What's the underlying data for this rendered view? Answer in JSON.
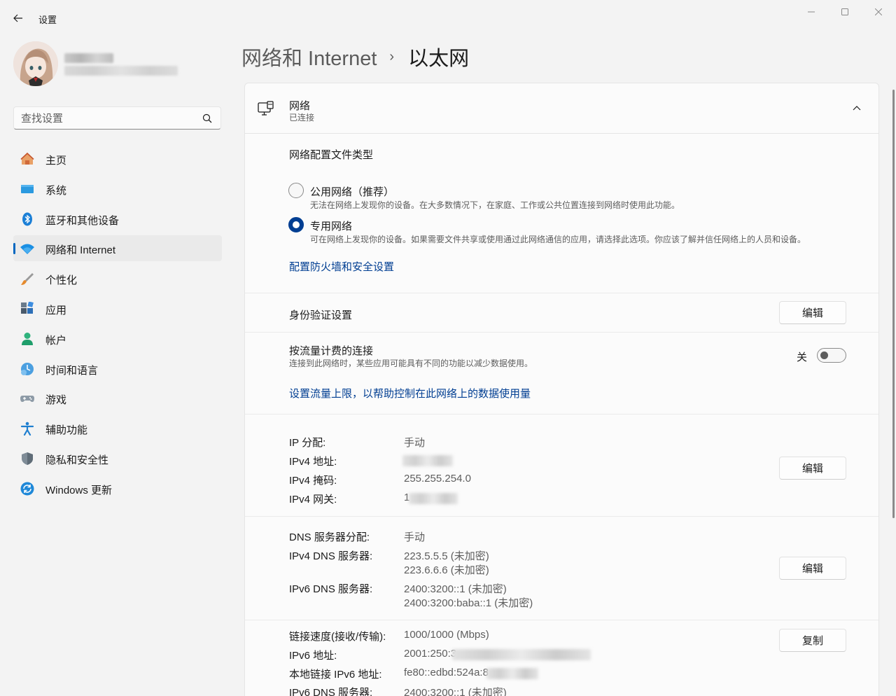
{
  "window": {
    "title": "设置",
    "controls": [
      "minimize-icon",
      "maximize-icon",
      "close-icon"
    ]
  },
  "search": {
    "placeholder": "查找设置"
  },
  "sidebar": {
    "items": [
      {
        "label": "主页",
        "icon": "home-icon",
        "active": false
      },
      {
        "label": "系统",
        "icon": "system-icon",
        "active": false
      },
      {
        "label": "蓝牙和其他设备",
        "icon": "bluetooth-icon",
        "active": false
      },
      {
        "label": "网络和 Internet",
        "icon": "network-wifi-icon",
        "active": true
      },
      {
        "label": "个性化",
        "icon": "brush-icon",
        "active": false
      },
      {
        "label": "应用",
        "icon": "apps-icon",
        "active": false
      },
      {
        "label": "帐户",
        "icon": "account-icon",
        "active": false
      },
      {
        "label": "时间和语言",
        "icon": "time-language-icon",
        "active": false
      },
      {
        "label": "游戏",
        "icon": "gamepad-icon",
        "active": false
      },
      {
        "label": "辅助功能",
        "icon": "accessibility-icon",
        "active": false
      },
      {
        "label": "隐私和安全性",
        "icon": "shield-icon",
        "active": false
      },
      {
        "label": "Windows 更新",
        "icon": "update-icon",
        "active": false
      }
    ]
  },
  "breadcrumb": {
    "parent": "网络和 Internet",
    "separator": "›",
    "current": "以太网"
  },
  "network_card": {
    "title": "网络",
    "status": "已连接",
    "profile": {
      "heading": "网络配置文件类型",
      "public_label": "公用网络（推荐）",
      "public_desc": "无法在网络上发现你的设备。在大多数情况下，在家庭、工作或公共位置连接到网络时使用此功能。",
      "private_label": "专用网络",
      "private_desc": "可在网络上发现你的设备。如果需要文件共享或使用通过此网络通信的应用，请选择此选项。你应该了解并信任网络上的人员和设备。",
      "selected": "private",
      "firewall_link": "配置防火墙和安全设置"
    },
    "auth": {
      "label": "身份验证设置",
      "button": "编辑"
    },
    "metered": {
      "label": "按流量计费的连接",
      "desc": "连接到此网络时，某些应用可能具有不同的功能以减少数据使用。",
      "state_text": "关",
      "on": false,
      "limit_link": "设置流量上限，以帮助控制在此网络上的数据使用量"
    },
    "ip": {
      "rows": [
        {
          "key": "IP 分配:",
          "value": "手动"
        },
        {
          "key": "IPv4 地址:",
          "value": ""
        },
        {
          "key": "IPv4 掩码:",
          "value": "255.255.254.0"
        },
        {
          "key": "IPv4 网关:",
          "value": "1"
        }
      ],
      "button": "编辑"
    },
    "dns": {
      "assign_key": "DNS 服务器分配:",
      "assign_value": "手动",
      "v4_key": "IPv4 DNS 服务器:",
      "v4_values": [
        "223.5.5.5 (未加密)",
        "223.6.6.6 (未加密)"
      ],
      "v6_key": "IPv6 DNS 服务器:",
      "v6_values": [
        "2400:3200::1 (未加密)",
        "2400:3200:baba::1 (未加密)"
      ],
      "button": "编辑"
    },
    "props": {
      "rows": [
        {
          "key": "链接速度(接收/传输):",
          "value": "1000/1000 (Mbps)"
        },
        {
          "key": "IPv6 地址:",
          "value": "2001:250:3"
        },
        {
          "key": "本地链接 IPv6 地址:",
          "value": "fe80::edbd:524a:8"
        },
        {
          "key": "IPv6 DNS 服务器:",
          "value": "2400:3200::1 (未加密)"
        }
      ],
      "button": "复制"
    }
  }
}
